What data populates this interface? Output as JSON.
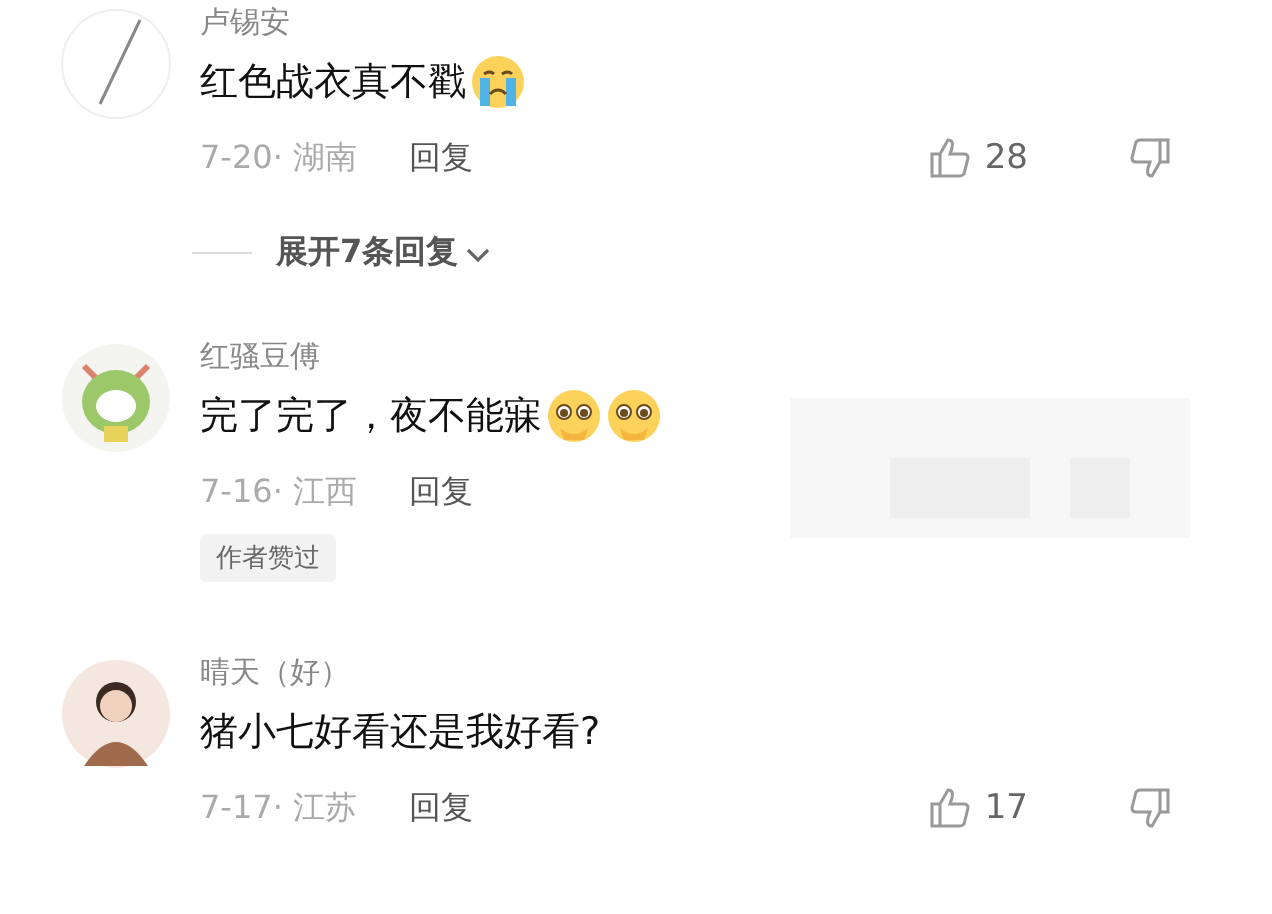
{
  "comments": [
    {
      "avatar": {
        "kind": "plain"
      },
      "name": "卢锡安",
      "text": "红色战衣真不戳",
      "emoji": [
        {
          "kind": "crying"
        }
      ],
      "date": "7-20·",
      "region": "湖南",
      "reply": "回复",
      "likes": "28",
      "expand_label": "展开7条回复"
    },
    {
      "avatar": {
        "kind": "cartoon"
      },
      "name": "红骚豆傅",
      "text": "完了完了，夜不能寐",
      "emoji": [
        {
          "kind": "pleading"
        },
        {
          "kind": "pleading"
        }
      ],
      "date": "7-16·",
      "region": "江西",
      "reply": "回复",
      "badge": "作者赞过"
    },
    {
      "avatar": {
        "kind": "photo"
      },
      "name": "晴天（好）",
      "text": "猪小七好看还是我好看?",
      "date": "7-17·",
      "region": "江苏",
      "reply": "回复",
      "likes": "17"
    }
  ]
}
